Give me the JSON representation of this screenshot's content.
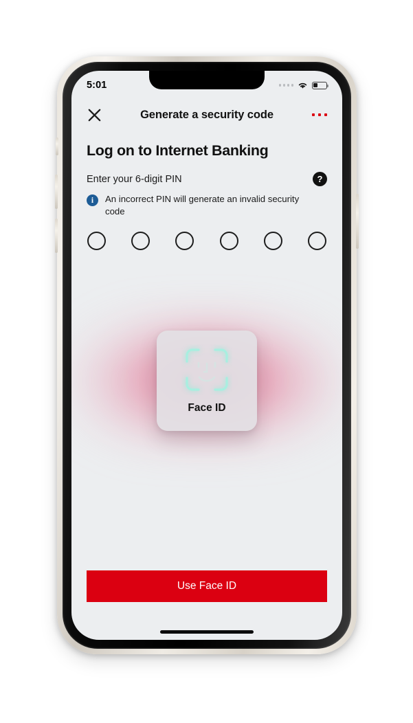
{
  "status_bar": {
    "time": "5:01",
    "signal_icon": "signal-dots-icon",
    "wifi_icon": "wifi-icon",
    "battery_icon": "battery-icon",
    "battery_percent": 35
  },
  "header": {
    "close_icon": "close-x-icon",
    "title": "Generate a security code",
    "more_icon": "more-options-icon"
  },
  "main": {
    "page_title": "Log on to Internet Banking",
    "pin_prompt": "Enter your 6-digit PIN",
    "help_icon_label": "?",
    "info_icon_label": "i",
    "hint_text": "An incorrect PIN will generate an invalid security code",
    "pin_length": 6,
    "pin_entered": 0
  },
  "faceid": {
    "label": "Face ID",
    "icon": "face-id-icon",
    "icon_color": "#a8efe0",
    "card_color": "#e2e0e4",
    "glow_color": "#d82056"
  },
  "cta": {
    "label": "Use Face ID",
    "color": "#db0011"
  },
  "colors": {
    "brand_red": "#db0011",
    "screen_bg": "#eceef0",
    "info_blue": "#1d5c96"
  }
}
